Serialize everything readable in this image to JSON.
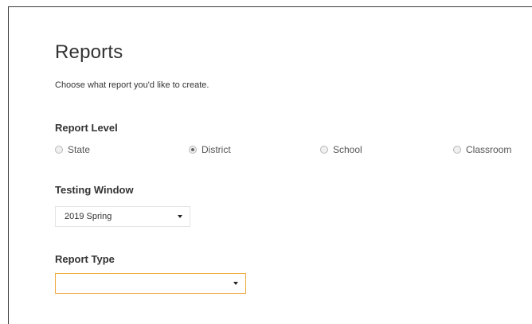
{
  "page": {
    "title": "Reports",
    "subtitle": "Choose what report you'd like to create."
  },
  "report_level": {
    "heading": "Report Level",
    "options": [
      {
        "label": "State",
        "selected": false
      },
      {
        "label": "District",
        "selected": true
      },
      {
        "label": "School",
        "selected": false
      },
      {
        "label": "Classroom",
        "selected": false
      }
    ]
  },
  "testing_window": {
    "heading": "Testing Window",
    "selected_value": "2019 Spring"
  },
  "report_type": {
    "heading": "Report Type",
    "selected_value": "",
    "focused": true
  },
  "colors": {
    "focus_border": "#f0a83a",
    "text": "#333333",
    "frame_border": "#3a3a3a"
  }
}
